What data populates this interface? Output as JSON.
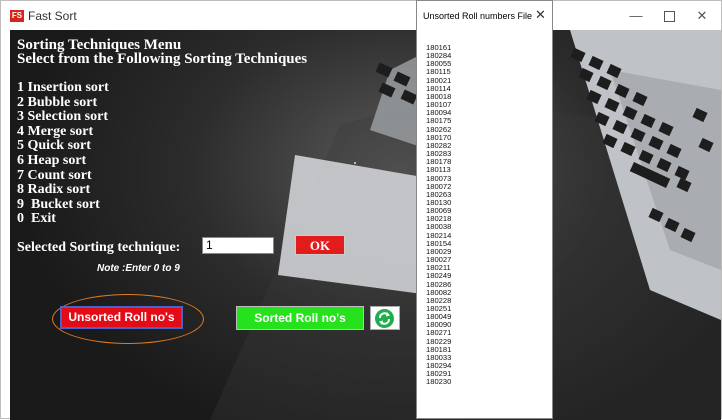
{
  "window": {
    "app_icon": "FS",
    "title": "Fast Sort",
    "minimize": "—",
    "close": "✕"
  },
  "menu": {
    "heading1": "Sorting Techniques Menu",
    "heading2": "Select from the Following Sorting Techniques",
    "items": [
      "1 Insertion sort",
      "2 Bubble sort",
      "3 Selection sort",
      "4 Merge sort",
      "5 Quick sort",
      "6 Heap sort",
      "7 Count sort",
      "8 Radix sort",
      "9  Bucket sort",
      "0  Exit"
    ]
  },
  "selection": {
    "label": "Selected Sorting technique:",
    "value": "1",
    "ok_label": "OK",
    "note": "Note :Enter 0 to 9"
  },
  "buttons": {
    "unsorted_label": "Unsorted Roll no's",
    "sorted_label": "Sorted Roll no's"
  },
  "popup": {
    "title": "Unsorted Roll numbers File",
    "close": "✕",
    "roll_numbers": [
      "180161",
      "180284",
      "180055",
      "180115",
      "180021",
      "180114",
      "180018",
      "180107",
      "180094",
      "180175",
      "180262",
      "180170",
      "180282",
      "180283",
      "180178",
      "180113",
      "180073",
      "180072",
      "180263",
      "180130",
      "180069",
      "180218",
      "180038",
      "180214",
      "180154",
      "180029",
      "180027",
      "180211",
      "180249",
      "180286",
      "180082",
      "180228",
      "180251",
      "180049",
      "180090",
      "180271",
      "180229",
      "180181",
      "180033",
      "180294",
      "180291",
      "180230"
    ]
  },
  "colors": {
    "ok": "#e21b1b",
    "unsorted": "#e30b16",
    "sorted": "#25e21c",
    "refresh": "#1fae4c",
    "highlight_ring": "#e07a20"
  }
}
